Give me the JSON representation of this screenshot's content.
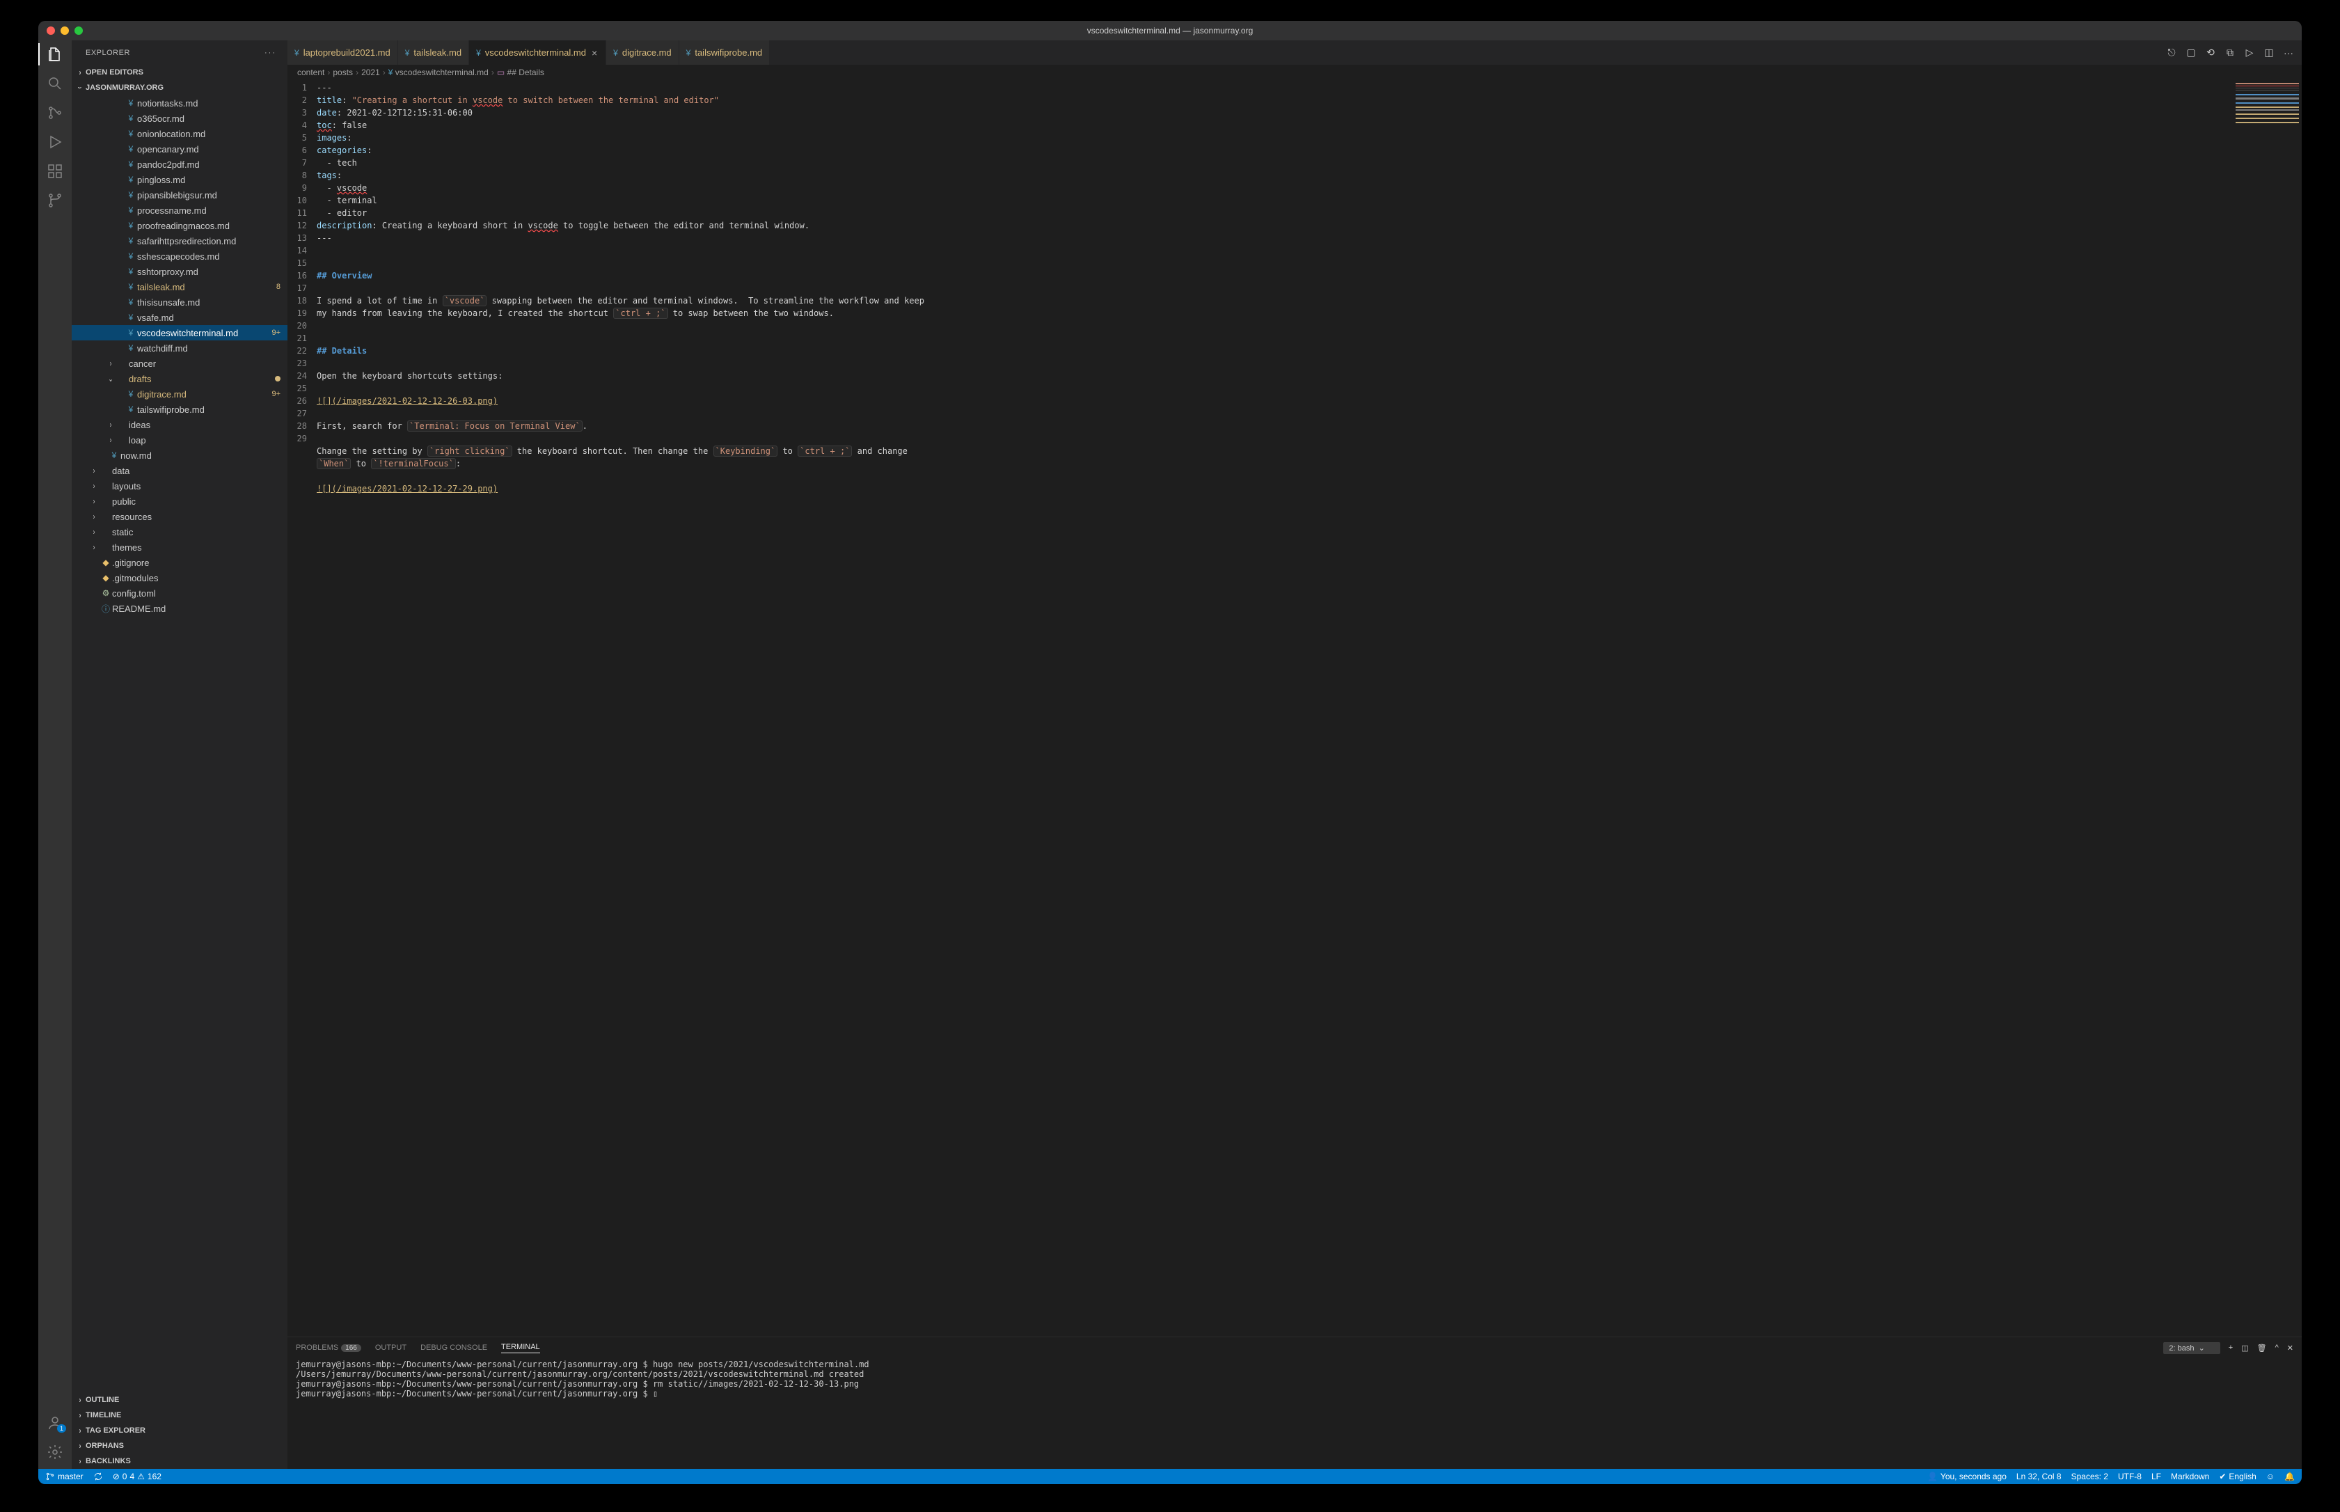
{
  "title": "vscodeswitchterminal.md — jasonmurray.org",
  "sidebar": {
    "title": "EXPLORER",
    "sections": {
      "open_editors": "OPEN EDITORS",
      "project": "JASONMURRAY.ORG",
      "outline": "OUTLINE",
      "timeline": "TIMELINE",
      "tag_explorer": "TAG EXPLORER",
      "orphans": "ORPHANS",
      "backlinks": "BACKLINKS"
    }
  },
  "files": [
    {
      "name": "notiontasks.md",
      "depth": 4,
      "type": "file",
      "mod": false
    },
    {
      "name": "o365ocr.md",
      "depth": 4,
      "type": "file",
      "mod": false
    },
    {
      "name": "onionlocation.md",
      "depth": 4,
      "type": "file",
      "mod": false
    },
    {
      "name": "opencanary.md",
      "depth": 4,
      "type": "file",
      "mod": false
    },
    {
      "name": "pandoc2pdf.md",
      "depth": 4,
      "type": "file",
      "mod": false
    },
    {
      "name": "pingloss.md",
      "depth": 4,
      "type": "file",
      "mod": false
    },
    {
      "name": "pipansiblebigsur.md",
      "depth": 4,
      "type": "file",
      "mod": false
    },
    {
      "name": "processname.md",
      "depth": 4,
      "type": "file",
      "mod": false
    },
    {
      "name": "proofreadingmacos.md",
      "depth": 4,
      "type": "file",
      "mod": false
    },
    {
      "name": "safarihttpsredirection.md",
      "depth": 4,
      "type": "file",
      "mod": false
    },
    {
      "name": "sshescapecodes.md",
      "depth": 4,
      "type": "file",
      "mod": false
    },
    {
      "name": "sshtorproxy.md",
      "depth": 4,
      "type": "file",
      "mod": false
    },
    {
      "name": "tailsleak.md",
      "depth": 4,
      "type": "file",
      "mod": true,
      "badge": "8"
    },
    {
      "name": "thisisunsafe.md",
      "depth": 4,
      "type": "file",
      "mod": false
    },
    {
      "name": "vsafe.md",
      "depth": 4,
      "type": "file",
      "mod": false
    },
    {
      "name": "vscodeswitchterminal.md",
      "depth": 4,
      "type": "file",
      "mod": true,
      "badge": "9+",
      "selected": true
    },
    {
      "name": "watchdiff.md",
      "depth": 4,
      "type": "file",
      "mod": false
    },
    {
      "name": "cancer",
      "depth": 3,
      "type": "folder",
      "mod": false
    },
    {
      "name": "drafts",
      "depth": 3,
      "type": "folder",
      "mod": true,
      "open": true,
      "dot": true
    },
    {
      "name": "digitrace.md",
      "depth": 4,
      "type": "file",
      "mod": true,
      "badge": "9+"
    },
    {
      "name": "tailswifiprobe.md",
      "depth": 4,
      "type": "file",
      "mod": false
    },
    {
      "name": "ideas",
      "depth": 3,
      "type": "folder",
      "mod": false
    },
    {
      "name": "loap",
      "depth": 3,
      "type": "folder",
      "mod": false
    },
    {
      "name": "now.md",
      "depth": 2,
      "type": "file",
      "mod": false
    },
    {
      "name": "data",
      "depth": 1,
      "type": "folder",
      "mod": false
    },
    {
      "name": "layouts",
      "depth": 1,
      "type": "folder",
      "mod": false
    },
    {
      "name": "public",
      "depth": 1,
      "type": "folder",
      "mod": false
    },
    {
      "name": "resources",
      "depth": 1,
      "type": "folder",
      "mod": false
    },
    {
      "name": "static",
      "depth": 1,
      "type": "folder",
      "mod": false
    },
    {
      "name": "themes",
      "depth": 1,
      "type": "folder",
      "mod": false
    },
    {
      "name": ".gitignore",
      "depth": 1,
      "type": "git",
      "mod": false
    },
    {
      "name": ".gitmodules",
      "depth": 1,
      "type": "git",
      "mod": false
    },
    {
      "name": "config.toml",
      "depth": 1,
      "type": "toml",
      "mod": false
    },
    {
      "name": "README.md",
      "depth": 1,
      "type": "info",
      "mod": false
    }
  ],
  "tabs": [
    {
      "label": "laptoprebuild2021.md",
      "active": false,
      "mod": true
    },
    {
      "label": "tailsleak.md",
      "active": false,
      "mod": true
    },
    {
      "label": "vscodeswitchterminal.md",
      "active": true,
      "mod": true
    },
    {
      "label": "digitrace.md",
      "active": false,
      "mod": true
    },
    {
      "label": "tailswifiprobe.md",
      "active": false,
      "mod": true
    }
  ],
  "breadcrumbs": [
    "content",
    "posts",
    "2021",
    "vscodeswitchterminal.md",
    "## Details"
  ],
  "editor": {
    "lines": [
      {
        "n": 1,
        "html": "---"
      },
      {
        "n": 2,
        "html": "<span class='k-key'>title</span>: <span class='k-str'>\"Creating a shortcut in <span class='squiggly'>vscode</span> to switch between the terminal and editor\"</span>"
      },
      {
        "n": 3,
        "html": "<span class='k-key'>date</span>: 2021-02-12T12:15:31-06:00"
      },
      {
        "n": 4,
        "html": "<span class='k-key squiggly'>toc</span>: false"
      },
      {
        "n": 5,
        "html": "<span class='k-key'>images</span>:"
      },
      {
        "n": 6,
        "html": "<span class='k-key'>categories</span>:"
      },
      {
        "n": 7,
        "html": "  <span class='k-dash'>-</span> tech"
      },
      {
        "n": 8,
        "html": "<span class='k-key'>tags</span>:"
      },
      {
        "n": 9,
        "html": "  <span class='k-dash'>-</span> <span class='squiggly'>vscode</span>"
      },
      {
        "n": 10,
        "html": "  <span class='k-dash'>-</span> terminal"
      },
      {
        "n": 11,
        "html": "  <span class='k-dash'>-</span> editor"
      },
      {
        "n": 12,
        "html": "<span class='k-key'>description</span>: Creating a keyboard short in <span class='squiggly'>vscode</span> to toggle between the editor and terminal window."
      },
      {
        "n": 13,
        "html": "---"
      },
      {
        "n": 14,
        "html": ""
      },
      {
        "n": "",
        "html": ""
      },
      {
        "n": 15,
        "html": "<span class='k-hdr'>## Overview</span>"
      },
      {
        "n": 16,
        "html": ""
      },
      {
        "n": 17,
        "html": "I spend a lot of time in <span class='k-code'>`vscode`</span> swapping between the editor and terminal windows.  To streamline the workflow and keep"
      },
      {
        "n": "",
        "html": "my hands from leaving the keyboard, I created the shortcut <span class='k-code'>`ctrl + ;`</span> to swap between the two windows."
      },
      {
        "n": 18,
        "html": ""
      },
      {
        "n": "",
        "html": ""
      },
      {
        "n": 19,
        "html": "<span class='k-hdr'>## Details</span>"
      },
      {
        "n": 20,
        "html": ""
      },
      {
        "n": 21,
        "html": "Open the keyboard shortcuts settings:"
      },
      {
        "n": 22,
        "html": ""
      },
      {
        "n": 23,
        "html": "<span class='k-link'>![](/images/2021-02-12-12-26-03.png)</span>"
      },
      {
        "n": 24,
        "html": ""
      },
      {
        "n": 25,
        "html": "First, search for <span class='k-code'>`Terminal: Focus on Terminal View`</span>."
      },
      {
        "n": 26,
        "html": ""
      },
      {
        "n": 27,
        "html": "Change the setting by <span class='k-code'>`right clicking`</span> the keyboard shortcut. Then change the <span class='k-code'>`Keybinding`</span> to <span class='k-code'>`ctrl + ;`</span> and change"
      },
      {
        "n": "",
        "html": "<span class='k-code'>`When`</span> to <span class='k-code'>`!terminalFocus`</span>:"
      },
      {
        "n": 28,
        "html": ""
      },
      {
        "n": 29,
        "html": "<span class='k-link'>![](/images/2021-02-12-12-27-29.png)</span>"
      }
    ]
  },
  "panel": {
    "problems": "PROBLEMS",
    "problems_count": "166",
    "output": "OUTPUT",
    "debug": "DEBUG CONSOLE",
    "terminal": "TERMINAL",
    "term_selector": "2: bash",
    "lines": [
      "jemurray@jasons-mbp:~/Documents/www-personal/current/jasonmurray.org $ hugo new posts/2021/vscodeswitchterminal.md",
      "/Users/jemurray/Documents/www-personal/current/jasonmurray.org/content/posts/2021/vscodeswitchterminal.md created",
      "jemurray@jasons-mbp:~/Documents/www-personal/current/jasonmurray.org $ rm static//images/2021-02-12-12-30-13.png",
      "jemurray@jasons-mbp:~/Documents/www-personal/current/jasonmurray.org $ ▯"
    ]
  },
  "status": {
    "branch": "master",
    "errors": "0",
    "errs_lead": "⊘",
    "warn_lead": "⚠",
    "warnings": "4",
    "warnings2": "162",
    "blame": "You, seconds ago",
    "pos": "Ln 32, Col 8",
    "spaces": "Spaces: 2",
    "encoding": "UTF-8",
    "eol": "LF",
    "lang": "Markdown",
    "spell": "English",
    "feedback": "☺",
    "bell": "🔔"
  },
  "account_badge": "1"
}
